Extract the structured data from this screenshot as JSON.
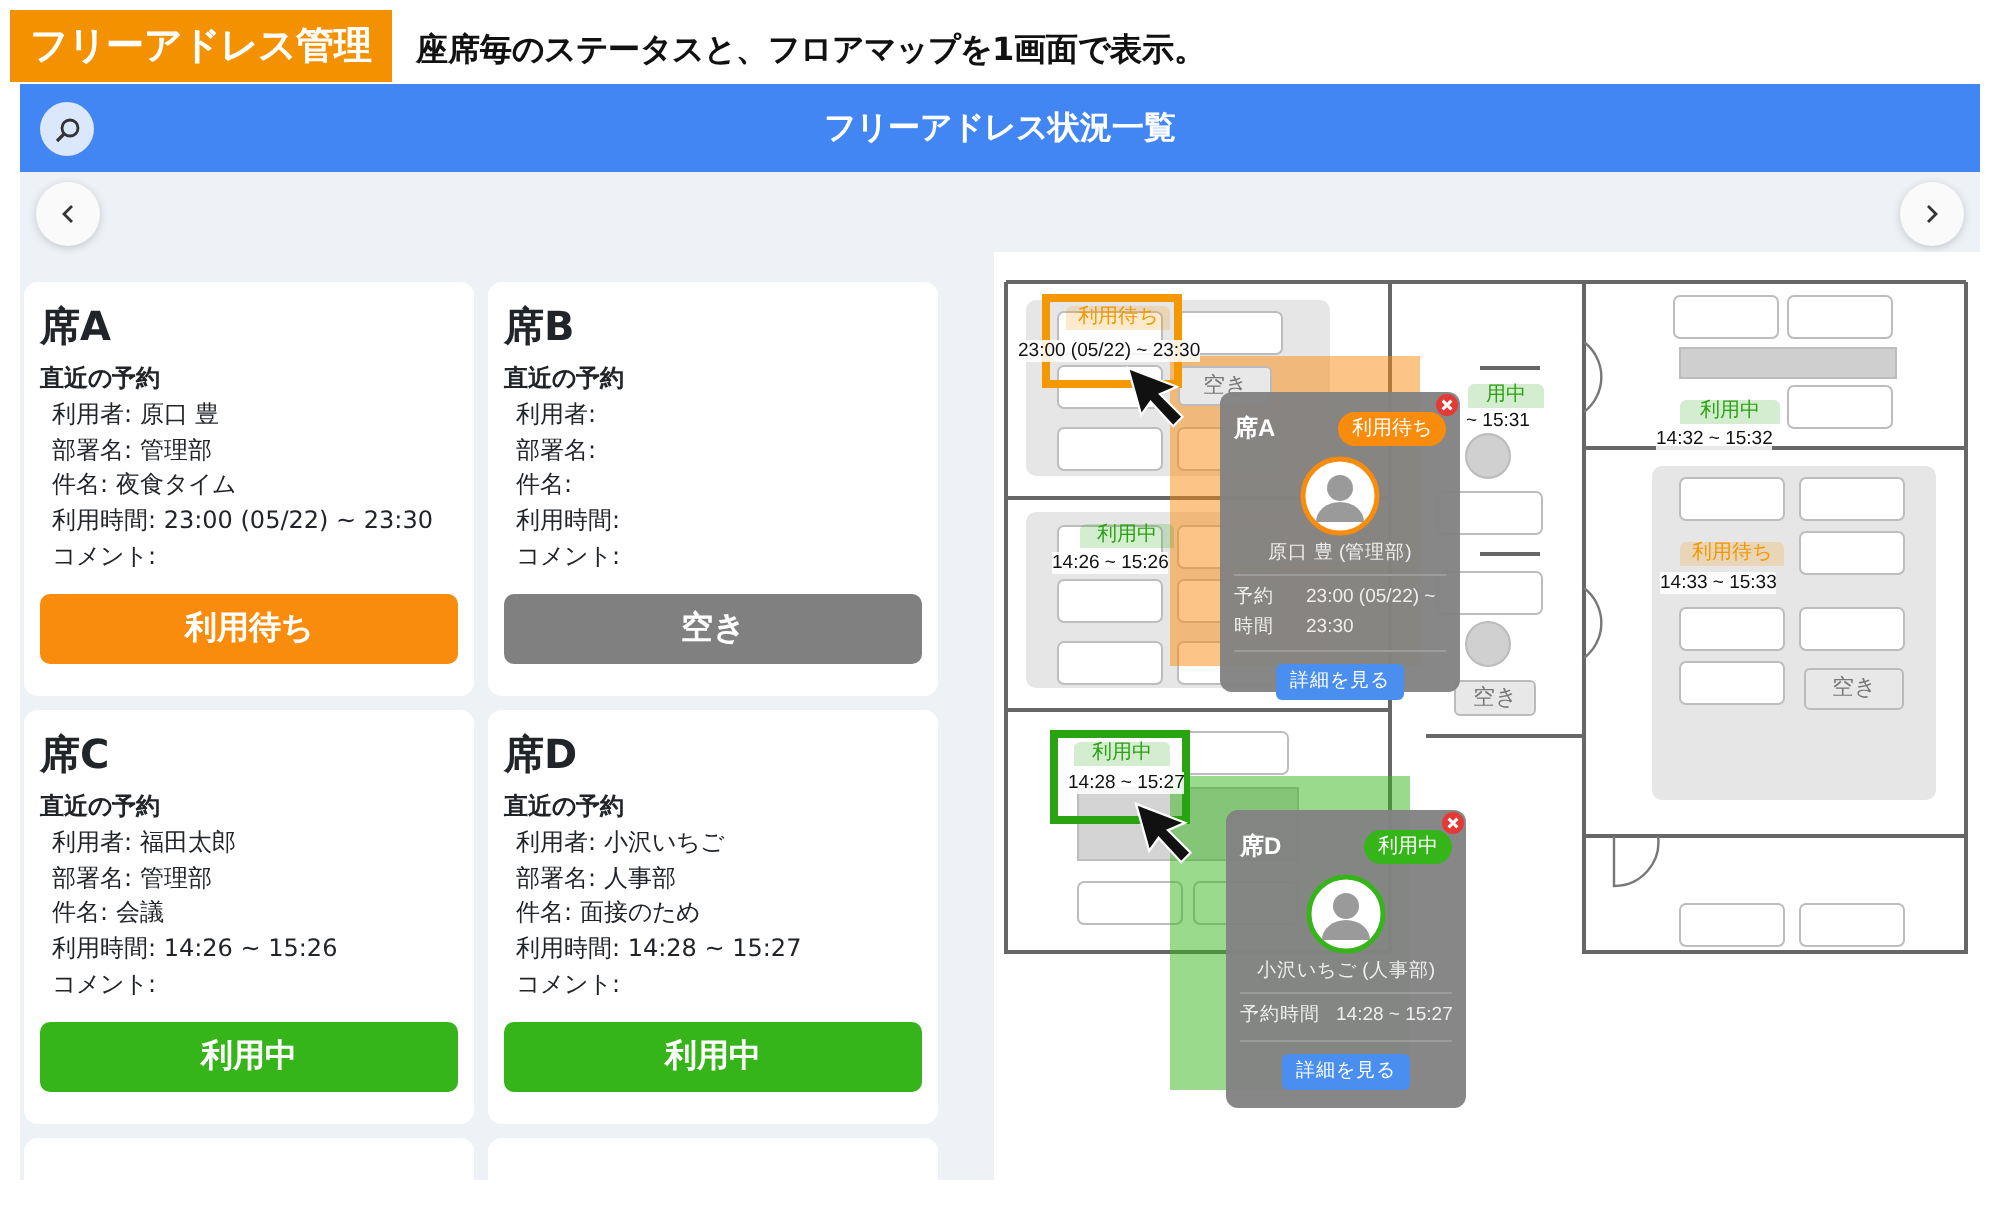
{
  "header": {
    "badge": "フリーアドレス管理",
    "caption": "座席毎のステータスと、フロアマップを1画面で表示。"
  },
  "app": {
    "title": "フリーアドレス状況一覧"
  },
  "cards": [
    {
      "kind": "full",
      "seat": "席A",
      "section": "直近の予約",
      "lines": [
        "利用者: 原口 豊",
        "部署名: 管理部",
        "件名: 夜食タイム",
        "利用時間: 23:00 (05/22) ~ 23:30",
        "コメント:"
      ],
      "color": "#f98c0c",
      "status_label": "利用待ち"
    },
    {
      "kind": "full",
      "seat": "席B",
      "section": "直近の予約",
      "lines": [
        "利用者:",
        "部署名:",
        "件名:",
        "利用時間:",
        "コメント:"
      ],
      "color": "#808080",
      "status_label": "空き"
    },
    {
      "kind": "full",
      "seat": "席C",
      "section": "直近の予約",
      "lines": [
        "利用者: 福田太郎",
        "部署名: 管理部",
        "件名: 会議",
        "利用時間: 14:26 ~ 15:26",
        "コメント:"
      ],
      "color": "#35b51a",
      "status_label": "利用中"
    },
    {
      "kind": "full",
      "seat": "席D",
      "section": "直近の予約",
      "lines": [
        "利用者: 小沢いちご",
        "部署名: 人事部",
        "件名: 面接のため",
        "利用時間: 14:28 ~ 15:27",
        "コメント:"
      ],
      "color": "#35b51a",
      "status_label": "利用中"
    },
    {
      "kind": "cut"
    },
    {
      "kind": "cut"
    }
  ],
  "map": {
    "seats": [
      {
        "color": "#f39800",
        "label": "利用待ち",
        "time": "23:00 (05/22) ~ 23:30",
        "highlighted": true
      },
      {
        "color": "#2aa312",
        "label": "用中",
        "time": "~ 15:31",
        "highlighted": false
      },
      {
        "color": "#2aa312",
        "label": "利用中",
        "time": "14:32 ~ 15:32",
        "highlighted": false
      },
      {
        "color": "#2aa312",
        "label": "利用中",
        "time": "14:26 ~ 15:26",
        "highlighted": false
      },
      {
        "color": "#f39800",
        "label": "利用待ち",
        "time": "14:33 ~ 15:33",
        "highlighted": false
      },
      {
        "color": "#2aa312",
        "label": "利用中",
        "time": "14:28 ~ 15:27",
        "highlighted": true
      }
    ],
    "vacant_seats": [
      "空き",
      "空き",
      "空き"
    ],
    "popups": [
      {
        "seat": "席A",
        "color": "#f98c0c",
        "status_label": "利用待ち",
        "person": "原口 豊 (管理部)",
        "time_label": "予約時間",
        "time": "23:00 (05/22) ~ 23:30",
        "button": "詳細を見る"
      },
      {
        "seat": "席D",
        "color": "#35b51a",
        "status_label": "利用中",
        "person": "小沢いちご (人事部)",
        "time_label": "予約時間",
        "time": "14:28 ~ 15:27",
        "button": "詳細を見る"
      }
    ]
  }
}
